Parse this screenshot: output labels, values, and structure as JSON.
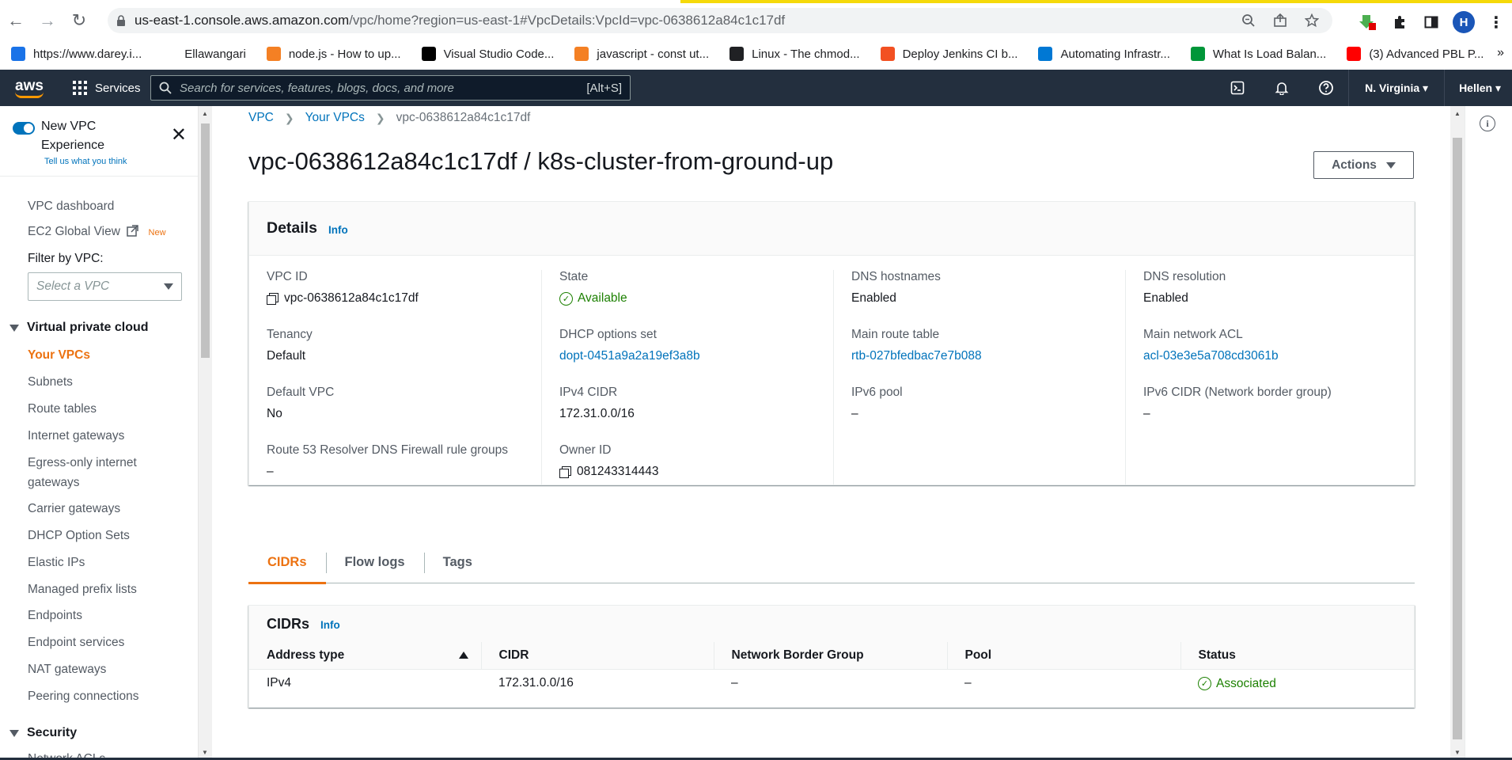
{
  "browser": {
    "url_host": "us-east-1.console.aws.amazon.com",
    "url_path": "/vpc/home?region=us-east-1#VpcDetails:VpcId=vpc-0638612a84c1c17df",
    "profile_initial": "H",
    "bookmarks": [
      {
        "label": "https://www.darey.i...",
        "color": "#1a73e8"
      },
      {
        "label": "Ellawangari",
        "color": "#ffffff"
      },
      {
        "label": "node.js - How to up...",
        "color": "#f48024"
      },
      {
        "label": "Visual Studio Code...",
        "color": "#000000"
      },
      {
        "label": "javascript - const ut...",
        "color": "#f48024"
      },
      {
        "label": "Linux - The chmod...",
        "color": "#202124"
      },
      {
        "label": "Deploy Jenkins CI b...",
        "color": "#f25022"
      },
      {
        "label": "Automating Infrastr...",
        "color": "#0078d4"
      },
      {
        "label": "What Is Load Balan...",
        "color": "#009639"
      },
      {
        "label": "(3) Advanced PBL P...",
        "color": "#ff0000"
      }
    ]
  },
  "aws_nav": {
    "logo": "aws",
    "services_label": "Services",
    "search_placeholder": "Search for services, features, blogs, docs, and more",
    "search_shortcut": "[Alt+S]",
    "region": "N. Virginia",
    "user": "Hellen"
  },
  "sidebar": {
    "new_vpc_title": "New VPC Experience",
    "tell_us": "Tell us what you think",
    "items_top": [
      {
        "label": "VPC dashboard"
      },
      {
        "label": "EC2 Global View",
        "badge": "New"
      }
    ],
    "filter_label": "Filter by VPC:",
    "filter_placeholder": "Select a VPC",
    "section_vpc": "Virtual private cloud",
    "vpc_items": [
      "Your VPCs",
      "Subnets",
      "Route tables",
      "Internet gateways",
      "Egress-only internet",
      "gateways",
      "Carrier gateways",
      "DHCP Option Sets",
      "Elastic IPs",
      "Managed prefix lists",
      "Endpoints",
      "Endpoint services",
      "NAT gateways",
      "Peering connections"
    ],
    "section_security": "Security",
    "partial_item": "Network ACLs"
  },
  "breadcrumb": {
    "root": "VPC",
    "parent": "Your VPCs",
    "current": "vpc-0638612a84c1c17df"
  },
  "page_title": "vpc-0638612a84c1c17df / k8s-cluster-from-ground-up",
  "actions_label": "Actions",
  "details": {
    "title": "Details",
    "info": "Info",
    "vpc_id_label": "VPC ID",
    "vpc_id": "vpc-0638612a84c1c17df",
    "tenancy_label": "Tenancy",
    "tenancy": "Default",
    "default_vpc_label": "Default VPC",
    "default_vpc": "No",
    "r53_label": "Route 53 Resolver DNS Firewall rule groups",
    "r53": "–",
    "state_label": "State",
    "state": "Available",
    "dhcp_label": "DHCP options set",
    "dhcp": "dopt-0451a9a2a19ef3a8b",
    "ipv4_label": "IPv4 CIDR",
    "ipv4": "172.31.0.0/16",
    "owner_label": "Owner ID",
    "owner": "081243314443",
    "dns_hostnames_label": "DNS hostnames",
    "dns_hostnames": "Enabled",
    "main_route_label": "Main route table",
    "main_route": "rtb-027bfedbac7e7b088",
    "ipv6_pool_label": "IPv6 pool",
    "ipv6_pool": "–",
    "dns_resolution_label": "DNS resolution",
    "dns_resolution": "Enabled",
    "main_acl_label": "Main network ACL",
    "main_acl": "acl-03e3e5a708cd3061b",
    "ipv6_cidr_label": "IPv6 CIDR (Network border group)",
    "ipv6_cidr": "–"
  },
  "tabs": [
    "CIDRs",
    "Flow logs",
    "Tags"
  ],
  "cidrs": {
    "title": "CIDRs",
    "info": "Info",
    "columns": [
      "Address type",
      "CIDR",
      "Network Border Group",
      "Pool",
      "Status"
    ],
    "rows": [
      {
        "address_type": "IPv4",
        "cidr": "172.31.0.0/16",
        "nbg": "–",
        "pool": "–",
        "status": "Associated"
      }
    ]
  },
  "colors": {
    "aws_nav": "#232f3e",
    "accent_orange": "#ec7211",
    "link_blue": "#0073bb",
    "success_green": "#1d8102"
  }
}
